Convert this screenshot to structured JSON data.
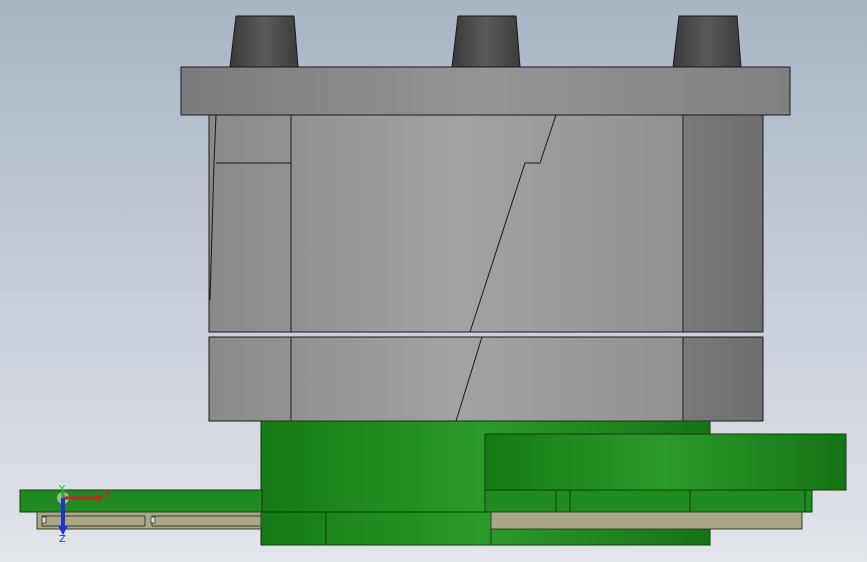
{
  "viewport": {
    "background_top": "#a9b4c4",
    "background_bottom": "#e2e5ea"
  },
  "colors": {
    "gray_part": "#9a9a9a",
    "dark_boss": "#4a4a4a",
    "green_part": "#1f8a1f",
    "tan_plate": "#a9a98a",
    "edge": "#1a1a1a"
  },
  "triad": {
    "x_label": "X",
    "y_label": "Y",
    "z_label": "Z",
    "x_color": "#cc2222",
    "y_color": "#22aa22",
    "z_color": "#2233cc"
  }
}
